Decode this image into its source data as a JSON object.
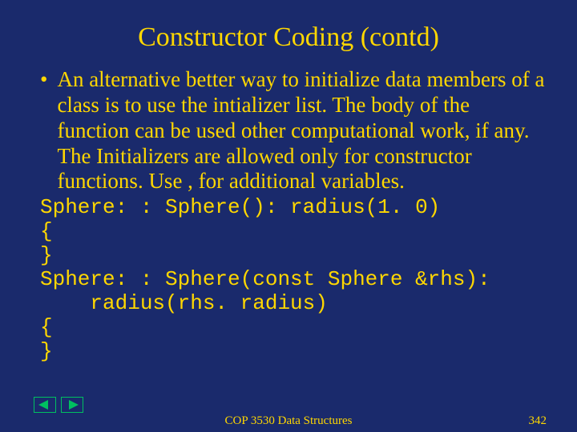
{
  "slide": {
    "title": "Constructor Coding (contd)",
    "bullet_text": "An alternative better way to initialize data members of a class is to use the intializer list. The body of the function can be used other computational work, if any. The Initializers are allowed only for constructor functions. Use , for additional variables.",
    "code": "Sphere: : Sphere(): radius(1. 0)\n{\n}\nSphere: : Sphere(const Sphere &rhs):\n    radius(rhs. radius)\n{\n}"
  },
  "footer": {
    "course": "COP 3530 Data Structures",
    "page": "342"
  },
  "nav": {
    "prev": "previous slide",
    "next": "next slide"
  }
}
